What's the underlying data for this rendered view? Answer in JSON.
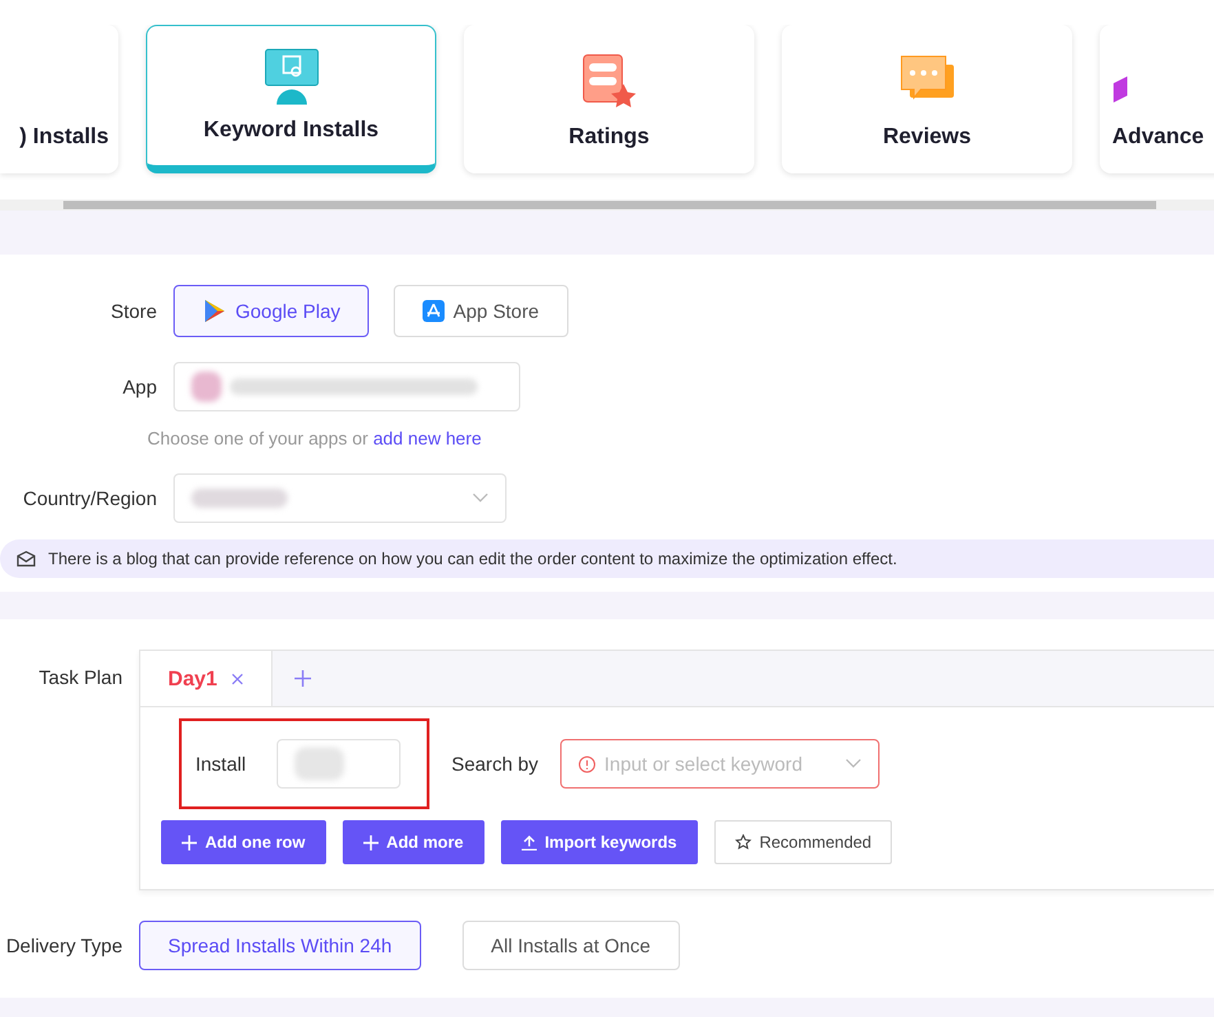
{
  "categories": [
    {
      "label": ") Installs",
      "selected": false
    },
    {
      "label": "Keyword Installs",
      "kind": "keyword",
      "selected": true
    },
    {
      "label": "Ratings",
      "kind": "ratings",
      "selected": false
    },
    {
      "label": "Reviews",
      "kind": "reviews",
      "selected": false
    },
    {
      "label": "Advance",
      "kind": "advanced",
      "selected": false
    }
  ],
  "form": {
    "store_label": "Store",
    "stores": [
      {
        "label": "Google Play",
        "kind": "google",
        "selected": true
      },
      {
        "label": "App Store",
        "kind": "apple",
        "selected": false
      }
    ],
    "app_label": "App",
    "app_hint": "Choose one of your apps or",
    "app_link": "add new here",
    "country_label": "Country/Region",
    "notice": "There is a blog that can provide reference on how you can edit the order content to maximize the optimization effect."
  },
  "task_plan": {
    "label": "Task Plan",
    "tabs": [
      {
        "label": "Day1",
        "selected": true
      }
    ],
    "install_label": "Install",
    "search_label": "Search by",
    "search_placeholder": "Input or select keyword",
    "buttons": [
      {
        "label": "Add one row",
        "kind": "add"
      },
      {
        "label": "Add more",
        "kind": "add"
      },
      {
        "label": "Import keywords",
        "kind": "import"
      },
      {
        "label": "Recommended",
        "kind": "recommend"
      }
    ]
  },
  "delivery": {
    "label": "Delivery Type",
    "options": [
      {
        "label": "Spread Installs Within 24h",
        "selected": true
      },
      {
        "label": "All Installs at Once",
        "selected": false
      }
    ]
  }
}
